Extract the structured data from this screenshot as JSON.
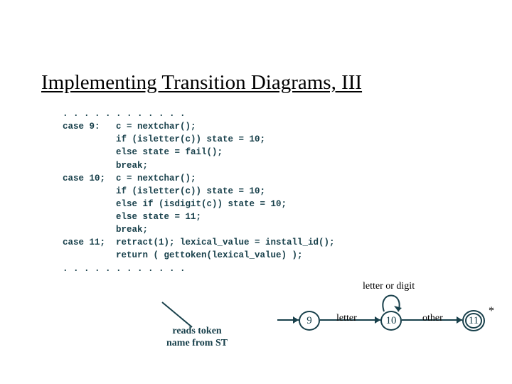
{
  "title": "Implementing Transition Diagrams, III",
  "code_lines": [
    ". . . . . . . . . . . .",
    "case 9:   c = nextchar();",
    "          if (isletter(c)) state = 10;",
    "          else state = fail();",
    "          break;",
    "case 10;  c = nextchar();",
    "          if (isletter(c)) state = 10;",
    "          else if (isdigit(c)) state = 10;",
    "          else state = 11;",
    "          break;",
    "case 11;  retract(1); lexical_value = install_id();",
    "          return ( gettoken(lexical_value) );",
    ". . . . . . . . . . . ."
  ],
  "caption": "reads token\nname from ST",
  "diagram": {
    "nodes": [
      {
        "id": "9",
        "label": "9"
      },
      {
        "id": "10",
        "label": "10"
      },
      {
        "id": "11",
        "label": "11",
        "accepting": true,
        "star": "*"
      }
    ],
    "edges": [
      {
        "from": "start",
        "to": "9"
      },
      {
        "from": "9",
        "to": "10",
        "label": "letter"
      },
      {
        "from": "10",
        "to": "10",
        "label": "letter or digit"
      },
      {
        "from": "10",
        "to": "11",
        "label": "other"
      }
    ]
  }
}
